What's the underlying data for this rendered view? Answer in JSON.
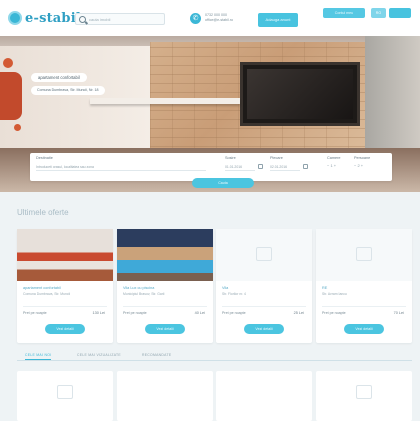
{
  "header": {
    "logo_text": "e-stabil.ro",
    "search_placeholder": "cauta imobil",
    "contact_line1": "0732 000 000",
    "contact_line2": "office@e-stabil.ro",
    "cta_button": "Adauga anunt",
    "user_button": "Contul meu",
    "lang_button": "RO"
  },
  "hero": {
    "title": "apartament confortabil",
    "address": "Comuna Dumbrava, Str. Muncii, Nr. 18"
  },
  "search_panel": {
    "destination_label": "Destinatie",
    "destination_placeholder": "Introduceti orasul, localitatea sau zona",
    "checkin_label": "Sosire",
    "checkin_value": "01.01.2016",
    "checkout_label": "Plecare",
    "checkout_value": "02.01.2016",
    "rooms_label": "Camere",
    "rooms_value": "1",
    "persons_label": "Persoane",
    "persons_value": "2",
    "submit_label": "Cauta"
  },
  "offers": {
    "section_title": "Ultimele oferte",
    "cards": [
      {
        "title": "apartament confortabil",
        "subtitle": "Comuna Dumbrava, Str. Muncii",
        "price_label": "Pret pe noapte",
        "price": "130 Lei",
        "button": "Vezi detalii",
        "image": "interior"
      },
      {
        "title": "Vila Lux cu piscina",
        "subtitle": "Municipiul Brasov, Str. Garii",
        "price_label": "Pret pe noapte",
        "price": "40 Lei",
        "button": "Vezi detalii",
        "image": "pool"
      },
      {
        "title": "Vila",
        "subtitle": "Str. Florilor nr. 4",
        "price_label": "Pret pe noapte",
        "price": "25 Lei",
        "button": "Vezi detalii",
        "image": "placeholder"
      },
      {
        "title": "RE",
        "subtitle": "Str. Avram Iancu",
        "price_label": "Pret pe noapte",
        "price": "70 Lei",
        "button": "Vezi detalii",
        "image": "placeholder"
      }
    ]
  },
  "tabs": [
    {
      "label": "CELE MAI NOI"
    },
    {
      "label": "CELE MAI VIZUALIZATE"
    },
    {
      "label": "RECOMANDATE"
    }
  ],
  "colors": {
    "accent": "#3bb7d6",
    "button": "#4bc5e0",
    "background": "#e9eef1"
  }
}
